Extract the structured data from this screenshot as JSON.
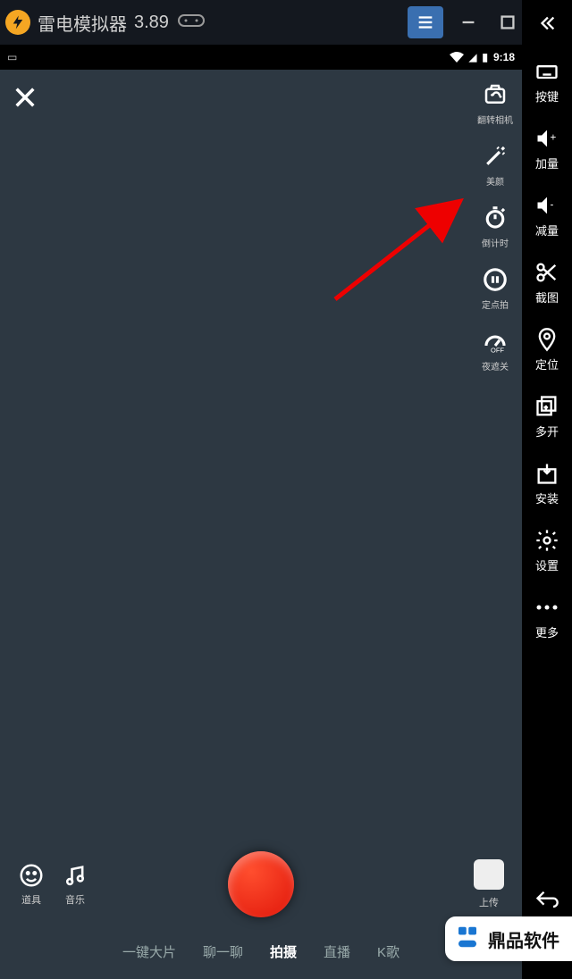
{
  "titlebar": {
    "app_name": "雷电模拟器",
    "version": "3.89"
  },
  "statusbar": {
    "time": "9:18"
  },
  "sidebar": {
    "items": [
      {
        "label": "按键",
        "icon": "keyboard"
      },
      {
        "label": "加量",
        "icon": "volume-up"
      },
      {
        "label": "减量",
        "icon": "volume-down"
      },
      {
        "label": "截图",
        "icon": "scissors"
      },
      {
        "label": "定位",
        "icon": "location"
      },
      {
        "label": "多开",
        "icon": "multi"
      },
      {
        "label": "安装",
        "icon": "install"
      },
      {
        "label": "设置",
        "icon": "gear"
      },
      {
        "label": "更多",
        "icon": "more"
      }
    ]
  },
  "cam_tools": [
    {
      "label": "翻转相机"
    },
    {
      "label": "美颜"
    },
    {
      "label": "倒计时"
    },
    {
      "label": "定点拍"
    },
    {
      "label": "夜遮关"
    }
  ],
  "bottom": {
    "props": "道具",
    "music": "音乐",
    "upload": "上传"
  },
  "tabs": [
    "一键大片",
    "聊一聊",
    "拍摄",
    "直播",
    "K歌"
  ],
  "active_tab": 2,
  "watermark": "鼎品软件"
}
